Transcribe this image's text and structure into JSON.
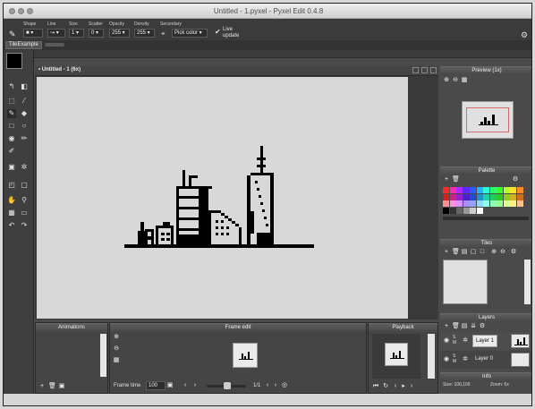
{
  "window": {
    "title": "Untitled - 1.pyxel - Pyxel Edit 0.4.8"
  },
  "toolbar": {
    "shape_label": "Shape",
    "line_label": "Line",
    "size_label": "Size",
    "scatter_label": "Scatter",
    "opacity_label": "Opacity",
    "density_label": "Density",
    "secondary_label": "Secondary",
    "size_value": "1",
    "scatter_value": "0",
    "opacity_value": "255",
    "density_value": "255",
    "secondary_value": "Pick color",
    "live_update_line1": "Live",
    "live_update_line2": "update"
  },
  "tileset_tab": "TileExample",
  "document_tab": "• Untitled - 1  (6x)",
  "panels": {
    "preview_title": "Preview (1x)",
    "palette_title": "Palette",
    "tiles_title": "Tiles",
    "layers_title": "Layers",
    "info_title": "Info",
    "animations_title": "Animations",
    "frame_edit_title": "Frame edit",
    "playback_title": "Playback"
  },
  "layers": [
    {
      "name": "Layer 1",
      "flag_s": "S",
      "flag_m": "M"
    },
    {
      "name": "Layer 0",
      "flag_s": "S",
      "flag_m": "M"
    }
  ],
  "info": {
    "size": "Size: 100,100",
    "zoom": "Zoom: 6x"
  },
  "frame_edit": {
    "frame_time_label": "Frame time",
    "frame_time_value": "100",
    "frame_count": "1/1"
  },
  "colors": {
    "palette": [
      "#ff2b2b",
      "#ff2bb0",
      "#b02bff",
      "#5a2bff",
      "#2b5aff",
      "#2bb0ff",
      "#2bffd8",
      "#2bff6a",
      "#3aff2b",
      "#b0ff2b",
      "#ffe02b",
      "#ff8a2b",
      "#cc2222",
      "#cc2290",
      "#9022cc",
      "#4a22cc",
      "#224acc",
      "#2290cc",
      "#22ccae",
      "#22cc55",
      "#2ecc22",
      "#90cc22",
      "#ccb322",
      "#cc6e22",
      "#ff8f8f",
      "#ff8fdb",
      "#d98fff",
      "#a68fff",
      "#8fa6ff",
      "#8fd9ff",
      "#8fffee",
      "#8fffb3",
      "#99ff8f",
      "#d9ff8f",
      "#fff08f",
      "#ffc28f"
    ],
    "grays": [
      "#000000",
      "#333333",
      "#666666",
      "#999999",
      "#cccccc",
      "#ffffff"
    ],
    "accent": "#e05a5a"
  }
}
